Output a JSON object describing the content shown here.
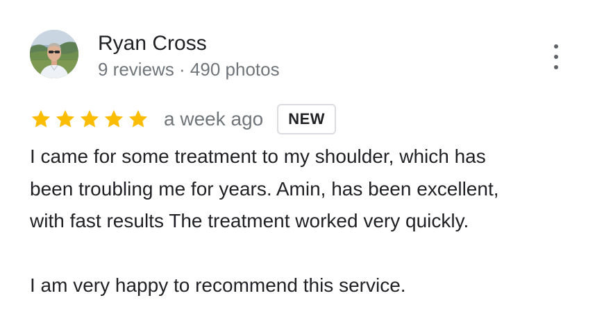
{
  "reviewer": {
    "name": "Ryan Cross",
    "meta": "9 reviews · 490 photos"
  },
  "rating": {
    "stars": 5,
    "max_stars": 5,
    "star_color": "#fbbc04",
    "time_ago": "a week ago",
    "badge": "NEW"
  },
  "review": {
    "paragraph_1": "I came for some treatment to my shoulder, which has\nbeen troubling me for years. Amin, has been excellent,\nwith fast results  The treatment worked very quickly.",
    "paragraph_2": "I am very happy to recommend this service."
  },
  "icons": {
    "menu": "more-vert-icon",
    "star": "star-icon",
    "avatar": "profile-photo"
  },
  "colors": {
    "text_primary": "#202124",
    "text_secondary": "#70757a",
    "badge_border": "#dadce0"
  }
}
